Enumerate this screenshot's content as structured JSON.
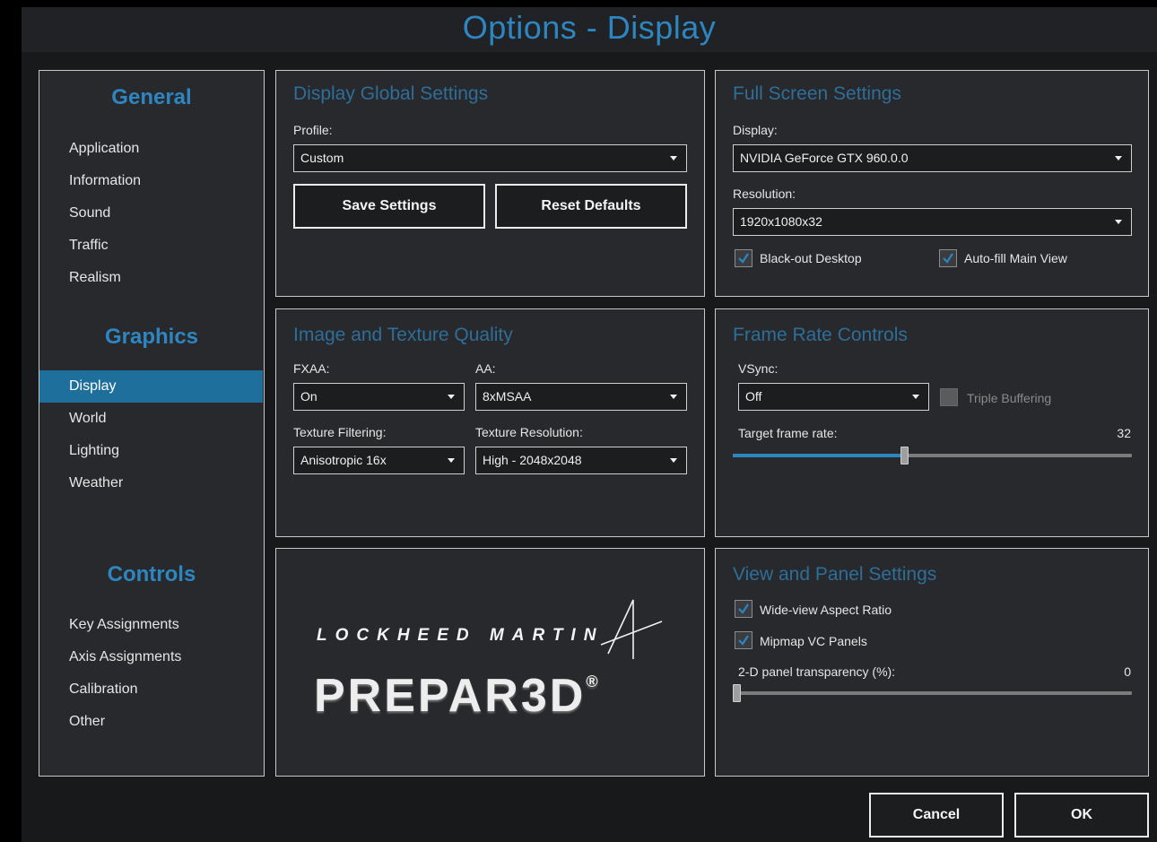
{
  "window": {
    "title": "Options - Display"
  },
  "sidebar": {
    "sections": [
      {
        "heading": "General",
        "items": [
          "Application",
          "Information",
          "Sound",
          "Traffic",
          "Realism"
        ]
      },
      {
        "heading": "Graphics",
        "items": [
          "Display",
          "World",
          "Lighting",
          "Weather"
        ]
      },
      {
        "heading": "Controls",
        "items": [
          "Key Assignments",
          "Axis Assignments",
          "Calibration",
          "Other"
        ]
      }
    ],
    "active_item": "Display"
  },
  "global_settings": {
    "title": "Display Global Settings",
    "profile_label": "Profile:",
    "profile_value": "Custom",
    "save_label": "Save Settings",
    "reset_label": "Reset Defaults"
  },
  "full_screen": {
    "title": "Full Screen Settings",
    "display_label": "Display:",
    "display_value": "NVIDIA GeForce GTX 960.0.0",
    "resolution_label": "Resolution:",
    "resolution_value": "1920x1080x32",
    "blackout_label": "Black-out Desktop",
    "blackout_checked": true,
    "autofill_label": "Auto-fill Main View",
    "autofill_checked": true
  },
  "image_quality": {
    "title": "Image and Texture Quality",
    "fxaa_label": "FXAA:",
    "fxaa_value": "On",
    "aa_label": "AA:",
    "aa_value": "8xMSAA",
    "filtering_label": "Texture Filtering:",
    "filtering_value": "Anisotropic 16x",
    "tex_res_label": "Texture Resolution:",
    "tex_res_value": "High - 2048x2048"
  },
  "frame_rate": {
    "title": "Frame Rate Controls",
    "vsync_label": "VSync:",
    "vsync_value": "Off",
    "triple_label": "Triple Buffering",
    "triple_checked": false,
    "target_label": "Target frame rate:",
    "target_value": "32",
    "target_fraction": 0.43
  },
  "logo": {
    "company": "LOCKHEED MARTIN",
    "product": "PREPAR3D",
    "registered": "®"
  },
  "view_panel": {
    "title": "View and Panel Settings",
    "wideview_label": "Wide-view Aspect Ratio",
    "wideview_checked": true,
    "mipmap_label": "Mipmap VC Panels",
    "mipmap_checked": true,
    "transparency_label": "2-D panel transparency (%):",
    "transparency_value": "0",
    "transparency_fraction": 0.0
  },
  "footer": {
    "cancel_label": "Cancel",
    "ok_label": "OK"
  },
  "colors": {
    "accent": "#2e86c1",
    "panel_bg": "#27292c",
    "border": "#c8c8c8"
  }
}
